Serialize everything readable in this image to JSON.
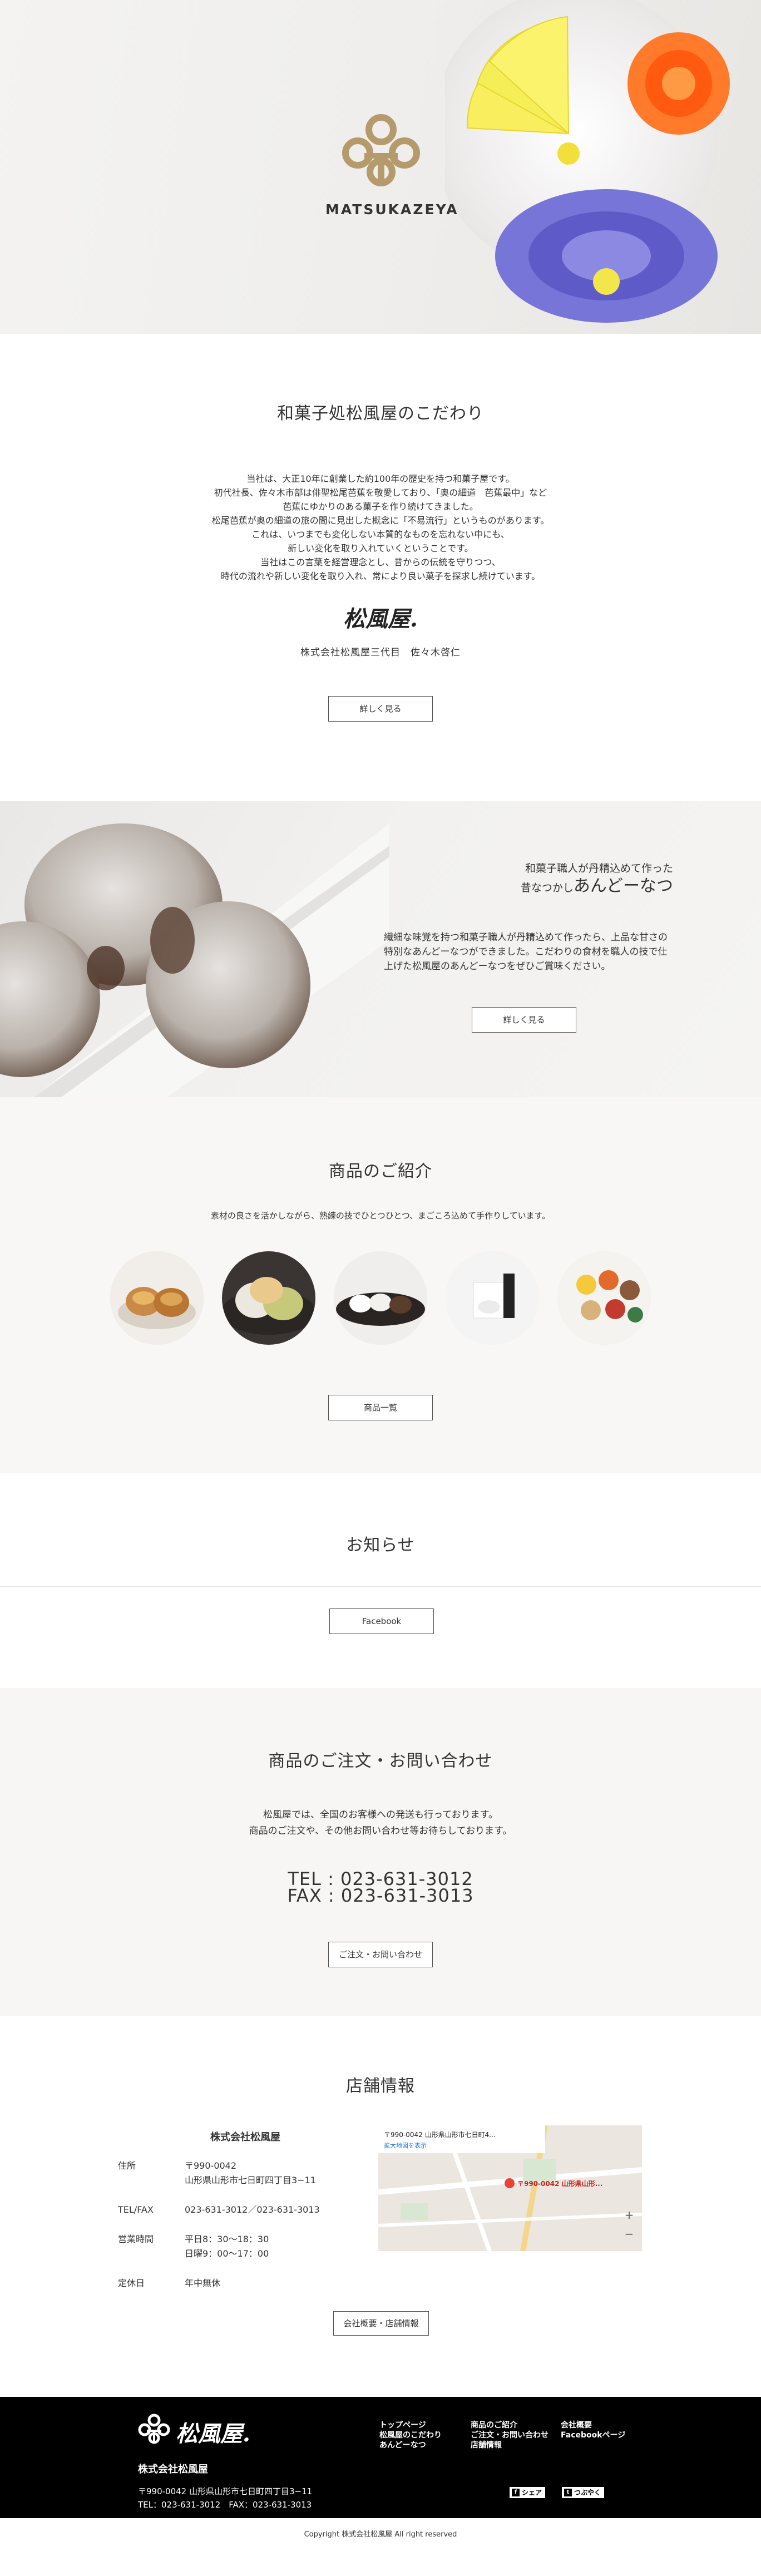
{
  "hero": {
    "brand": "MATSUKAZEYA"
  },
  "about": {
    "title": "和菓子処松風屋のこだわり",
    "lines": [
      "当社は、大正10年に創業した約100年の歴史を持つ和菓子屋です。",
      "初代社長、佐々木市部は俳聖松尾芭蕉を敬愛しており、「奥の細道　芭蕉最中」など",
      "芭蕉にゆかりのある菓子を作り続けてきました。",
      "松尾芭蕉が奥の細道の旅の間に見出した概念に「不易流行」というものがあります。",
      "これは、いつまでも変化しない本質的なものを忘れない中にも、",
      "新しい変化を取り入れていくということです。",
      "当社はこの言葉を経営理念とし、昔からの伝統を守りつつ、",
      "時代の流れや新しい変化を取り入れ、常により良い菓子を探求し続けています。"
    ],
    "signature": "松風屋.",
    "president": "株式会社松風屋三代目　佐々木啓仁",
    "button": "詳しく見る"
  },
  "donut": {
    "catch1": "和菓子職人が丹精込めて作った",
    "catch2_small": "昔なつかし",
    "catch2_big": "あんどーなつ",
    "body": "繊細な味覚を持つ和菓子職人が丹精込めて作ったら、上品な甘さの特別なあんどーなつができました。こだわりの食材を職人の技で仕上げた松風屋のあんどーなつをぜひご賞味ください。",
    "button": "詳しく見る"
  },
  "products": {
    "title": "商品のご紹介",
    "desc": "素材の良さを活かしながら、熟練の技でひとつひとつ、まごころ込めて手作りしています。",
    "button": "商品一覧"
  },
  "news": {
    "title": "お知らせ",
    "button": "Facebook"
  },
  "contact": {
    "title": "商品のご注文・お問い合わせ",
    "lines": [
      "松風屋では、全国のお客様への発送も行っております。",
      "商品のご注文や、その他お問い合わせ等お待ちしております。"
    ],
    "tel": "TEL : 023-631-3012",
    "fax": "FAX : 023-631-3013",
    "button": "ご注文・お問い合わせ"
  },
  "store": {
    "title": "店舗情報",
    "company": "株式会社松風屋",
    "rows": [
      {
        "k": "住所",
        "v1": "〒990-0042",
        "v2": "山形県山形市七日町四丁目3−11"
      },
      {
        "k": "TEL/FAX",
        "v1": "023-631-3012／023-631-3013",
        "v2": ""
      },
      {
        "k": "営業時間",
        "v1": "平日8：30～18：30",
        "v2": "日曜9：00～17：00"
      },
      {
        "k": "定休日",
        "v1": "年中無休",
        "v2": ""
      }
    ],
    "map_label": "〒990-0042 山形県山形市七日町4...",
    "map_sublabel": "拡大地図を表示",
    "map_pin": "〒990-0042 山形県山形...",
    "button": "会社概要・店舗情報"
  },
  "footer": {
    "logo": "松風屋.",
    "name": "株式会社松風屋",
    "addr1": "〒990-0042 山形県山形市七日町四丁目3−11",
    "addr2": "TEL：023-631-3012　FAX：023-631-3013",
    "nav1": [
      "トップページ",
      "松風屋のこだわり",
      "あんどーなつ"
    ],
    "nav2": [
      "商品のご紹介",
      "ご注文・お問い合わせ",
      "店舗情報"
    ],
    "nav3": [
      "会社概要",
      "Facebookページ"
    ],
    "share": "シェア",
    "tweet": "つぶやく"
  },
  "copyright": "Copyright 株式会社松風屋 All right reserved"
}
